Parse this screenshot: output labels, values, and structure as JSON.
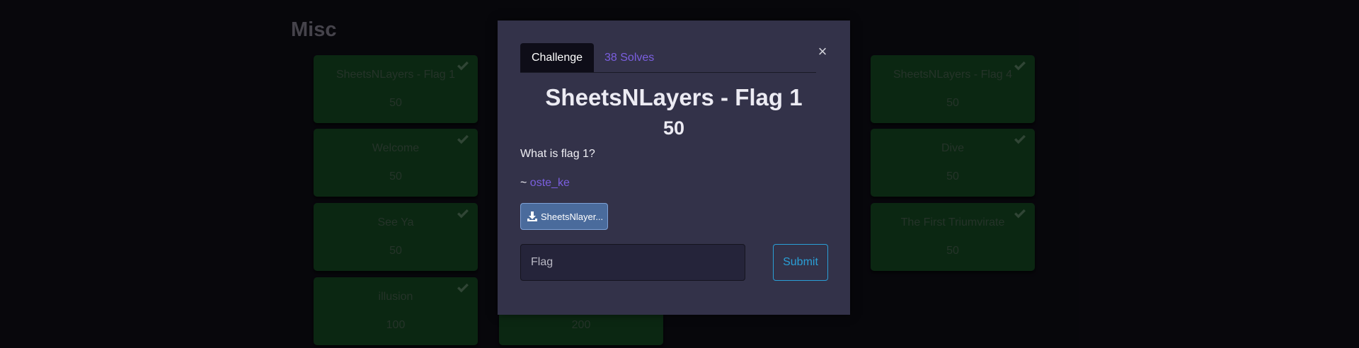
{
  "category": {
    "title": "Misc"
  },
  "cards": [
    {
      "name": "SheetsNLayers - Flag 1",
      "value": "50"
    },
    {
      "name": "SheetsNLayers - Flag 4",
      "value": "50"
    },
    {
      "name": "Welcome",
      "value": "50"
    },
    {
      "name": "Dive",
      "value": "50"
    },
    {
      "name": "See Ya",
      "value": "50"
    },
    {
      "name": "The First Triumvirate",
      "value": "50"
    },
    {
      "name": "illusion",
      "value": "100"
    },
    {
      "name": "",
      "value": "200"
    }
  ],
  "modal": {
    "tabs": {
      "challenge": "Challenge",
      "solves": "38 Solves"
    },
    "close_glyph": "×",
    "challenge_name": "SheetsNLayers - Flag 1",
    "challenge_value": "50",
    "description": "What is flag 1?",
    "author_prefix": "~ ",
    "author_name": "oste_ke",
    "file_label": "SheetsNlayer...",
    "flag_placeholder": "Flag",
    "submit_label": "Submit"
  },
  "icons": {
    "solved": "check-icon",
    "download": "download-icon"
  },
  "colors": {
    "card_bg": "#123d1c",
    "modal_bg": "#333249",
    "accent_purple": "#7b5fe0",
    "submit_blue": "#2a9fd6"
  }
}
